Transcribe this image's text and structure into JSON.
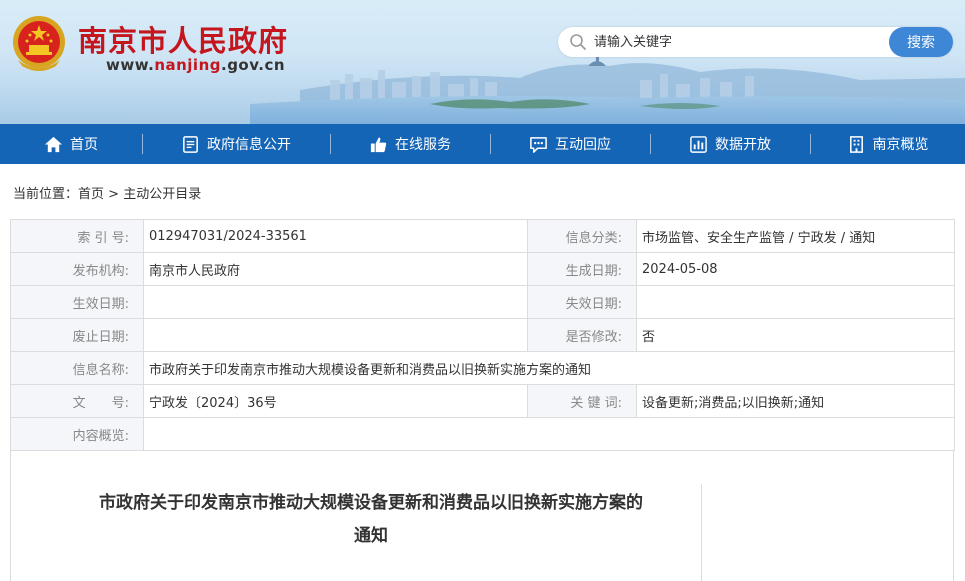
{
  "header": {
    "site_title": "南京市人民政府",
    "url_prefix": "www.",
    "url_highlight": "nanjing",
    "url_suffix": ".gov.cn",
    "search_placeholder": "请输入关键字",
    "search_button": "搜索"
  },
  "nav": {
    "items": [
      {
        "label": "首页",
        "icon": "home-icon"
      },
      {
        "label": "政府信息公开",
        "icon": "document-icon"
      },
      {
        "label": "在线服务",
        "icon": "thumbs-up-icon"
      },
      {
        "label": "互动回应",
        "icon": "chat-icon"
      },
      {
        "label": "数据开放",
        "icon": "bar-chart-icon"
      },
      {
        "label": "南京概览",
        "icon": "building-icon"
      }
    ]
  },
  "breadcrumb": {
    "prefix": "当前位置：",
    "home": "首页",
    "separator": " > ",
    "current": "主动公开目录"
  },
  "info": {
    "index_label": "索 引 号:",
    "index_value": "012947031/2024-33561",
    "category_label": "信息分类:",
    "category_value": "市场监管、安全生产监管 / 宁政发 / 通知",
    "issuer_label": "发布机构:",
    "issuer_value": "南京市人民政府",
    "created_label": "生成日期:",
    "created_value": "2024-05-08",
    "effective_label": "生效日期:",
    "effective_value": "",
    "expiry_label": "失效日期:",
    "expiry_value": "",
    "abolish_label": "废止日期:",
    "abolish_value": "",
    "modified_label": "是否修改:",
    "modified_value": "否",
    "name_label": "信息名称:",
    "name_value": "市政府关于印发南京市推动大规模设备更新和消费品以旧换新实施方案的通知",
    "doc_no_label": "文　　号:",
    "doc_no_value": "宁政发〔2024〕36号",
    "keywords_label": "关 键 词:",
    "keywords_value": "设备更新;消费品;以旧换新;通知",
    "summary_label": "内容概览:",
    "summary_value": ""
  },
  "article": {
    "title_line1": "市政府关于印发南京市推动大规模设备更新和消费品以旧换新实施方案的",
    "title_line2": "通知"
  },
  "colors": {
    "brand_red": "#c4161c",
    "nav_blue": "#1565b7",
    "search_button_blue": "#3e87d6",
    "label_bg": "#f4f6f9"
  }
}
